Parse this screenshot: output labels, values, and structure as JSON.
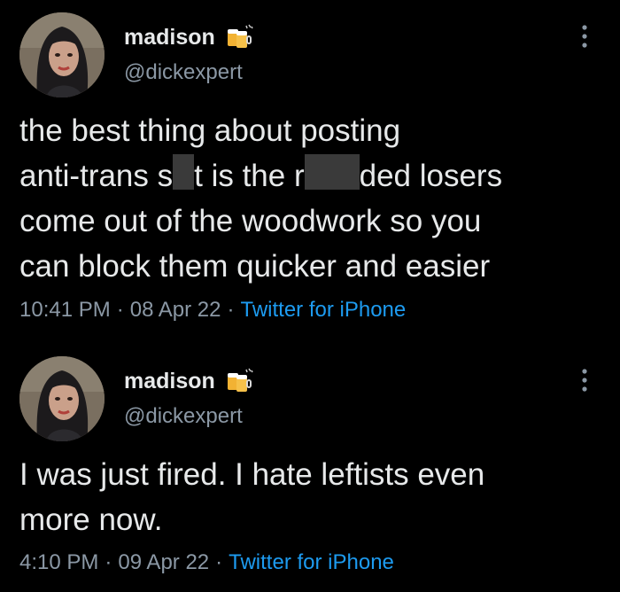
{
  "colors": {
    "background": "#000000",
    "text": "#e7e9ea",
    "secondary_text": "#8b98a5",
    "link": "#1d9bf0"
  },
  "tweets": [
    {
      "author": {
        "display_name": "madison",
        "handle": "@dickexpert",
        "badge_icon": "beer-mugs-icon"
      },
      "text_lines": [
        "the best thing about posting",
        [
          "anti-trans s",
          "t is the r",
          "ded losers"
        ],
        "come out of the woodwork so you",
        "can block them quicker and easier"
      ],
      "time": "10:41 PM",
      "date": "08 Apr 22",
      "source": "Twitter for iPhone",
      "separator": "·"
    },
    {
      "author": {
        "display_name": "madison",
        "handle": "@dickexpert",
        "badge_icon": "beer-mugs-icon"
      },
      "text_lines": [
        "I was just fired. I hate leftists even",
        "more now."
      ],
      "time": "4:10 PM",
      "date": "09 Apr 22",
      "source": "Twitter for iPhone",
      "separator": "·"
    }
  ]
}
